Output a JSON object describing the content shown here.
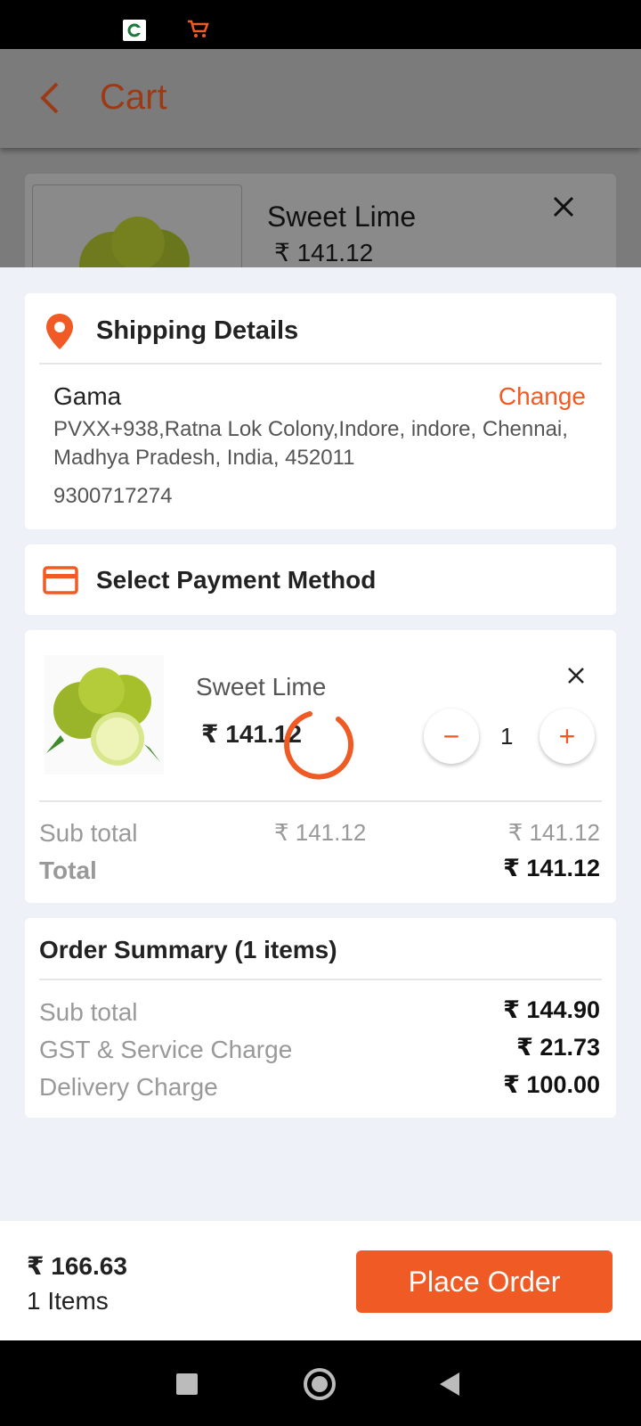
{
  "background_page": {
    "title": "Cart",
    "item_name": "Sweet Lime",
    "item_price": "₹ 141.12"
  },
  "shipping": {
    "title": "Shipping Details",
    "name": "Gama",
    "change_label": "Change",
    "address": "PVXX+938,Ratna Lok Colony,Indore, indore, Chennai, Madhya Pradesh, India, 452011",
    "phone": "9300717274"
  },
  "payment": {
    "title": "Select Payment Method"
  },
  "item": {
    "name": "Sweet Lime",
    "price": "₹ 141.12",
    "quantity": "1",
    "minus_label": "−",
    "plus_label": "+",
    "subtotal_label": "Sub total",
    "subtotal_unit": "₹ 141.12",
    "subtotal_value": "₹ 141.12",
    "total_label": "Total",
    "total_value": "₹ 141.12"
  },
  "summary": {
    "title": "Order Summary (1 items)",
    "rows": [
      {
        "label": "Sub total",
        "value": "₹ 144.90"
      },
      {
        "label": "GST & Service Charge",
        "value": "₹ 21.73"
      },
      {
        "label": "Delivery Charge",
        "value": "₹ 100.00"
      }
    ]
  },
  "footer": {
    "total": "₹ 166.63",
    "items": "1 Items",
    "place_order": "Place Order"
  },
  "colors": {
    "accent": "#f05a24",
    "background": "#eef2f8"
  }
}
